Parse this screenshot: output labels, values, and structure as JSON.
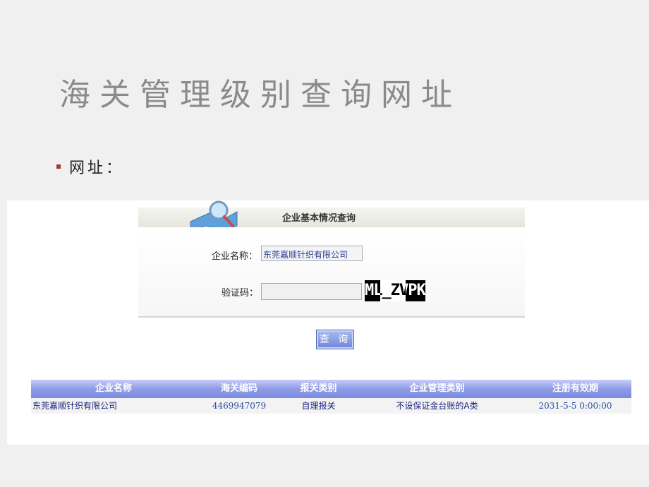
{
  "slide": {
    "title": "海关管理级别查询网址",
    "bullet": "网址："
  },
  "form": {
    "header_title": "企业基本情况查询",
    "company_label": "企业名称：",
    "company_value": "东莞嘉顺针织有限公司",
    "captcha_label": "验证码：",
    "captcha_value": "",
    "captcha_image_text": "ML_ZVPK",
    "search_button": "查 询"
  },
  "results": {
    "columns": [
      "企业名称",
      "海关编码",
      "报关类别",
      "企业管理类别",
      "注册有效期"
    ],
    "rows": [
      {
        "company": "东莞嘉顺针织有限公司",
        "customs_code": "4469947079",
        "declaration_type": "自理报关",
        "management_category": "不设保证金台账的A类",
        "valid_until": "2031-5-5 0:00:00"
      }
    ]
  },
  "colors": {
    "table_header": "#8f9ce6",
    "button": "#6d86d6",
    "bullet": "#a0392b"
  }
}
